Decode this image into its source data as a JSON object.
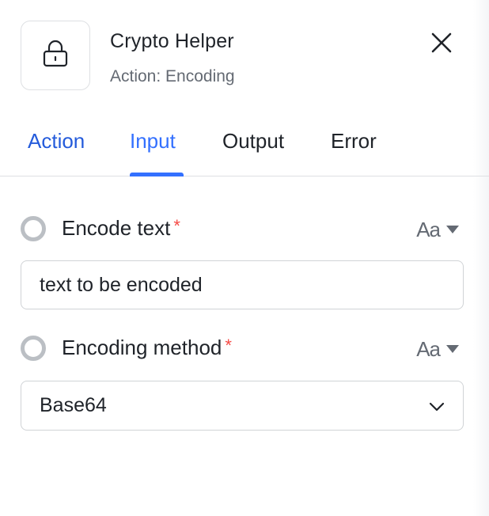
{
  "header": {
    "icon": "lock-icon",
    "title": "Crypto Helper",
    "subtitle": "Action: Encoding",
    "close_icon": "close-icon"
  },
  "tabs": [
    {
      "label": "Action",
      "active": false
    },
    {
      "label": "Input",
      "active": true
    },
    {
      "label": "Output",
      "active": false
    },
    {
      "label": "Error",
      "active": false
    }
  ],
  "fields": [
    {
      "label": "Encode text",
      "required_mark": "*",
      "type_toggle": "Aa",
      "value": "text to be encoded"
    },
    {
      "label": "Encoding method",
      "required_mark": "*",
      "type_toggle": "Aa",
      "selected": "Base64"
    }
  ],
  "colors": {
    "accent": "#3370ff",
    "required": "#f54a45",
    "muted_text": "#646a73",
    "border": "#dee0e3"
  }
}
